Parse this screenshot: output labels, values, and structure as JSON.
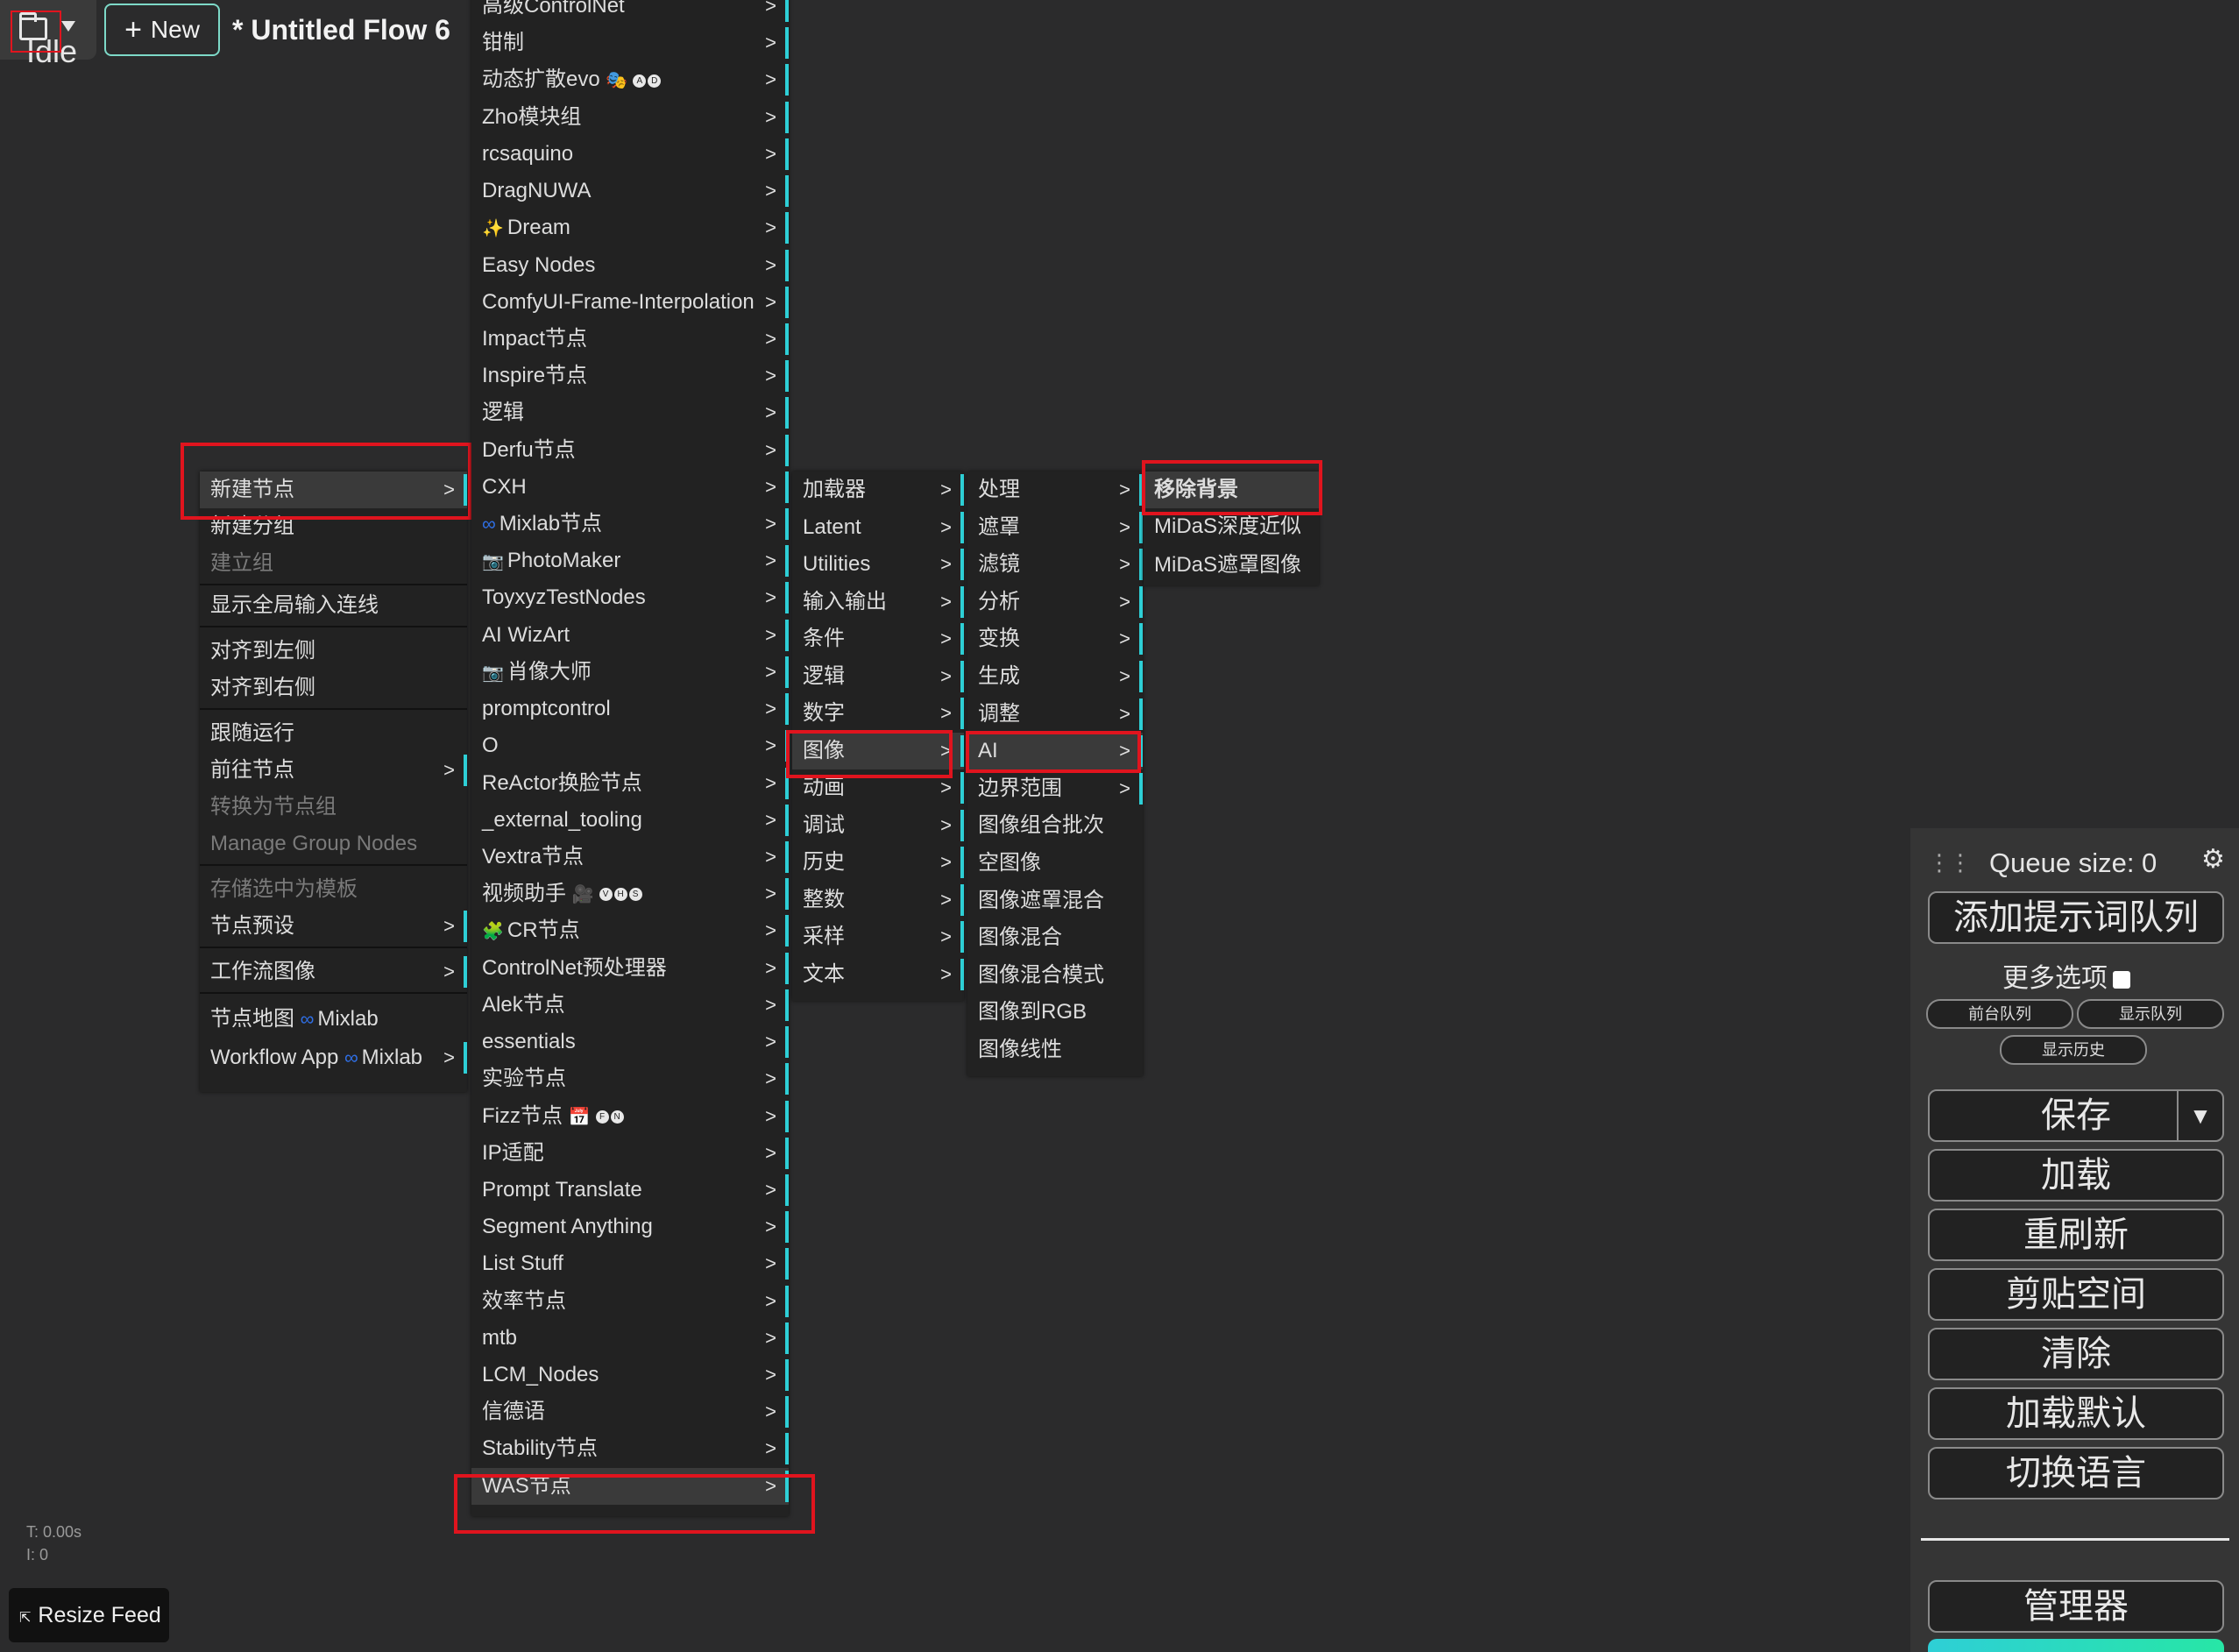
{
  "header": {
    "status_label": "Idle",
    "new_button_label": "New",
    "flow_title": "* Untitled Flow 6"
  },
  "context_menu": {
    "items": [
      {
        "label": "新建节点",
        "submenu": true,
        "disabled": false
      },
      {
        "label": "新建分组",
        "submenu": false,
        "disabled": false
      },
      {
        "label": "建立组",
        "submenu": false,
        "disabled": true
      },
      {
        "label": "显示全局输入连线",
        "submenu": false,
        "disabled": false
      },
      {
        "label": "对齐到左侧",
        "submenu": false,
        "disabled": false
      },
      {
        "label": "对齐到右侧",
        "submenu": false,
        "disabled": false
      },
      {
        "label": "跟随运行",
        "submenu": false,
        "disabled": false
      },
      {
        "label": "前往节点",
        "submenu": true,
        "disabled": false
      },
      {
        "label": "转换为节点组",
        "submenu": false,
        "disabled": true
      },
      {
        "label": "Manage Group Nodes",
        "submenu": false,
        "disabled": true
      },
      {
        "label": "存储选中为模板",
        "submenu": false,
        "disabled": true
      },
      {
        "label": "节点预设",
        "submenu": true,
        "disabled": false
      },
      {
        "label": "工作流图像",
        "submenu": true,
        "disabled": false
      },
      {
        "label": "节点地图",
        "suffix": "Mixlab",
        "submenu": false,
        "disabled": false
      },
      {
        "label": "Workflow App",
        "suffix": "Mixlab",
        "submenu": true,
        "disabled": false
      }
    ]
  },
  "node_categories": {
    "items": [
      "高级ControlNet",
      "钳制",
      "动态扩散evo",
      "Zho模块组",
      "rcsaquino",
      "DragNUWA",
      "Dream",
      "Easy Nodes",
      "ComfyUI-Frame-Interpolation",
      "Impact节点",
      "Inspire节点",
      "逻辑",
      "Derfu节点",
      "CXH",
      "Mixlab节点",
      "PhotoMaker",
      "ToyxyzTestNodes",
      "AI WizArt",
      "肖像大师",
      "promptcontrol",
      "O",
      "ReActor换脸节点",
      "_external_tooling",
      "Vextra节点",
      "视频助手",
      "CR节点",
      "ControlNet预处理器",
      "Alek节点",
      "essentials",
      "实验节点",
      "Fizz节点",
      "IP适配",
      "Prompt Translate",
      "Segment Anything",
      "List Stuff",
      "效率节点",
      "mtb",
      "LCM_Nodes",
      "信德语",
      "Stability节点",
      "WAS节点"
    ],
    "arrow": ">"
  },
  "was_submenu": {
    "items": [
      "加载器",
      "Latent",
      "Utilities",
      "输入输出",
      "条件",
      "逻辑",
      "数字",
      "图像",
      "动画",
      "调试",
      "历史",
      "整数",
      "采样",
      "文本"
    ]
  },
  "image_submenu": {
    "items": [
      {
        "label": "处理",
        "submenu": true
      },
      {
        "label": "遮罩",
        "submenu": true
      },
      {
        "label": "滤镜",
        "submenu": true
      },
      {
        "label": "分析",
        "submenu": true
      },
      {
        "label": "变换",
        "submenu": true
      },
      {
        "label": "生成",
        "submenu": true
      },
      {
        "label": "调整",
        "submenu": true
      },
      {
        "label": "AI",
        "submenu": true
      },
      {
        "label": "边界范围",
        "submenu": true
      },
      {
        "label": "图像组合批次",
        "submenu": false
      },
      {
        "label": "空图像",
        "submenu": false
      },
      {
        "label": "图像遮罩混合",
        "submenu": false
      },
      {
        "label": "图像混合",
        "submenu": false
      },
      {
        "label": "图像混合模式",
        "submenu": false
      },
      {
        "label": "图像到RGB",
        "submenu": false
      },
      {
        "label": "图像线性",
        "submenu": false
      }
    ]
  },
  "ai_submenu": {
    "items": [
      "移除背景",
      "MiDaS深度近似",
      "MiDaS遮罩图像"
    ]
  },
  "queue_panel": {
    "queue_size": "Queue size: 0",
    "queue_prompt": "添加提示词队列",
    "extra_options": "更多选项",
    "queue_front": "前台队列",
    "view_queue": "显示队列",
    "view_history": "显示历史",
    "save": "保存",
    "save_dropdown": "▼",
    "load": "加载",
    "refresh": "重刷新",
    "clipspace": "剪贴空间",
    "clear": "清除",
    "load_default": "加载默认",
    "switch_language": "切换语言",
    "manager": "管理器"
  },
  "stats": {
    "time": "T: 0.00s",
    "iter": "I: 0"
  },
  "resize_feed": "Resize Feed",
  "colors": {
    "accent": "#2ecfd6",
    "highlight_box": "#e0141e",
    "background": "#2b2b2c",
    "menu_bg": "#222222"
  }
}
